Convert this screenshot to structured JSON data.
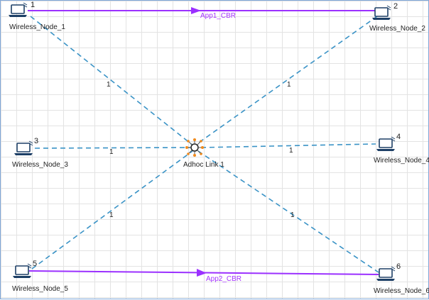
{
  "network": {
    "hub": {
      "name": "Adhoc Link 1"
    },
    "nodes": [
      {
        "id": "1",
        "name": "Wireless_Node_1"
      },
      {
        "id": "2",
        "name": "Wireless_Node_2"
      },
      {
        "id": "3",
        "name": "Wireless_Node_3"
      },
      {
        "id": "4",
        "name": "Wireless_Node_4"
      },
      {
        "id": "5",
        "name": "Wireless_Node_5"
      },
      {
        "id": "6",
        "name": "Wireless_Node_6"
      }
    ],
    "link_labels": [
      "1",
      "1",
      "1",
      "1",
      "1",
      "1"
    ],
    "applications": [
      {
        "name": "App1_CBR",
        "from": "1",
        "to": "2"
      },
      {
        "name": "App2_CBR",
        "from": "5",
        "to": "6"
      }
    ]
  },
  "colors": {
    "link": "#3a93c6",
    "application": "#9b30ff",
    "grid": "#e3e3e3",
    "border": "#7fa7d9"
  }
}
